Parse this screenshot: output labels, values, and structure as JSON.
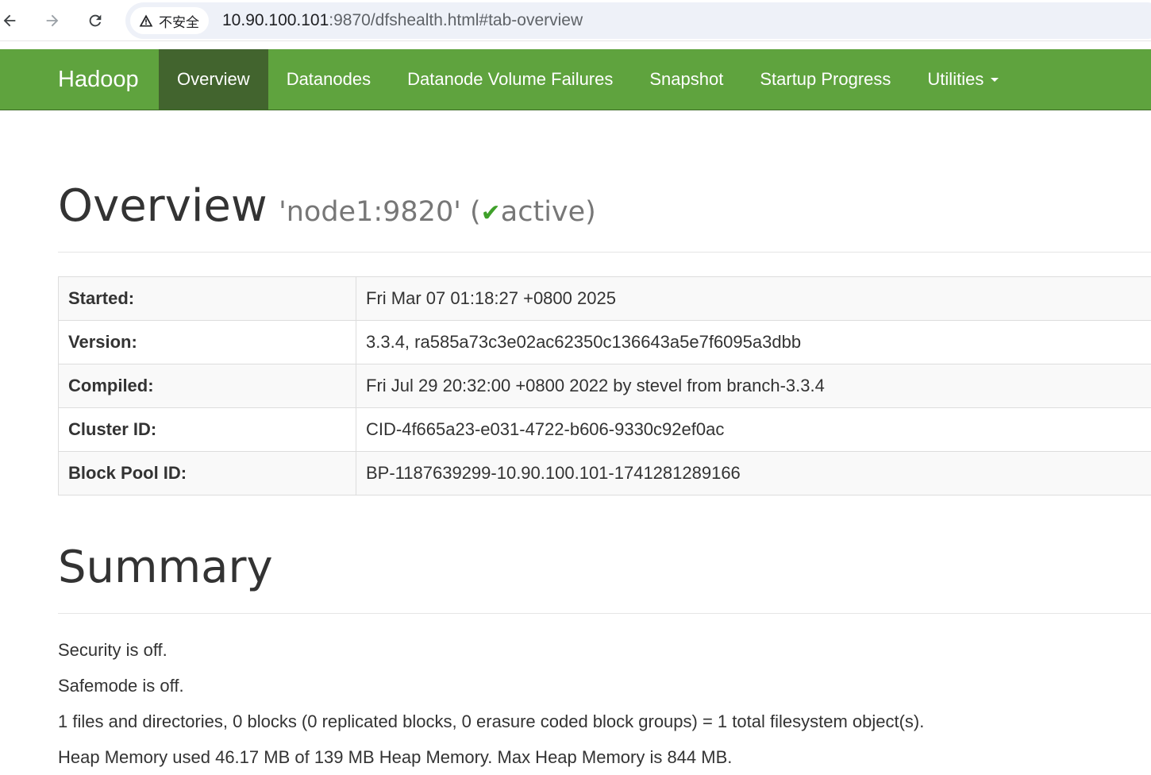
{
  "browser": {
    "security_label": "不安全",
    "url_host": "10.90.100.101",
    "url_rest": ":9870/dfshealth.html#tab-overview"
  },
  "navbar": {
    "brand": "Hadoop",
    "items": [
      {
        "label": "Overview",
        "active": true
      },
      {
        "label": "Datanodes"
      },
      {
        "label": "Datanode Volume Failures"
      },
      {
        "label": "Snapshot"
      },
      {
        "label": "Startup Progress"
      },
      {
        "label": "Utilities"
      }
    ]
  },
  "overview": {
    "title": "Overview",
    "node": "'node1:9820'",
    "status_open": "(",
    "status_check": "✔",
    "status": "active)",
    "rows": [
      {
        "key": "Started:",
        "value": "Fri Mar 07 01:18:27 +0800 2025"
      },
      {
        "key": "Version:",
        "value": "3.3.4, ra585a73c3e02ac62350c136643a5e7f6095a3dbb"
      },
      {
        "key": "Compiled:",
        "value": "Fri Jul 29 20:32:00 +0800 2022 by stevel from branch-3.3.4"
      },
      {
        "key": "Cluster ID:",
        "value": "CID-4f665a23-e031-4722-b606-9330c92ef0ac"
      },
      {
        "key": "Block Pool ID:",
        "value": "BP-1187639299-10.90.100.101-1741281289166"
      }
    ]
  },
  "summary": {
    "title": "Summary",
    "lines": [
      "Security is off.",
      "Safemode is off.",
      "1 files and directories, 0 blocks (0 replicated blocks, 0 erasure coded block groups) = 1 total filesystem object(s).",
      "Heap Memory used 46.17 MB of 139 MB Heap Memory. Max Heap Memory is 844 MB."
    ]
  },
  "colors": {
    "navbar": "#5fa33e",
    "navbar_active": "#42642e",
    "check": "#3fa02a"
  }
}
